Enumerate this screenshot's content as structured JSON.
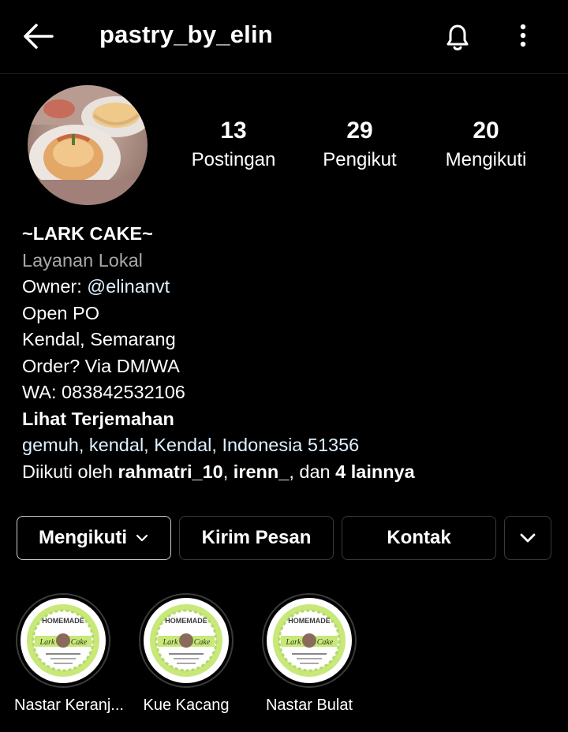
{
  "header": {
    "username": "pastry_by_elin",
    "icons": [
      "back-arrow-icon",
      "bell-icon",
      "more-vertical-icon"
    ]
  },
  "stats": [
    {
      "value": "13",
      "label": "Postingan"
    },
    {
      "value": "29",
      "label": "Pengikut"
    },
    {
      "value": "20",
      "label": "Mengikuti"
    }
  ],
  "bio": {
    "name": "~LARK CAKE~",
    "category": "Layanan Lokal",
    "owner_prefix": "Owner: ",
    "owner_handle": "@elinanvt",
    "lines": [
      "Open PO",
      "Kendal, Semarang",
      "Order? Via DM/WA",
      "WA: 083842532106"
    ],
    "translate": "Lihat Terjemahan",
    "address": "gemuh, kendal, Kendal, Indonesia 51356",
    "followed_prefix": "Diikuti oleh ",
    "followed_user1": "rahmatri_10",
    "followed_sep": ", ",
    "followed_user2": "irenn_",
    "followed_and": ", dan ",
    "followed_more": "4 lainnya"
  },
  "buttons": {
    "following": "Mengikuti",
    "message": "Kirim Pesan",
    "contact": "Kontak"
  },
  "highlights": [
    {
      "label": "Nastar Keranj...",
      "badge_top": "HOMEMADE",
      "badge_left": "Lark",
      "badge_right": "Cake"
    },
    {
      "label": "Kue Kacang",
      "badge_top": "HOMEMADE",
      "badge_left": "Lark",
      "badge_right": "Cake"
    },
    {
      "label": "Nastar Bulat",
      "badge_top": "HOMEMADE",
      "badge_left": "Lark",
      "badge_right": "Cake"
    }
  ],
  "colors": {
    "background": "#000000",
    "text": "#ffffff",
    "secondary": "#a8a8a8",
    "link": "#e0f1ff",
    "badge_green": "#c8e87a"
  }
}
